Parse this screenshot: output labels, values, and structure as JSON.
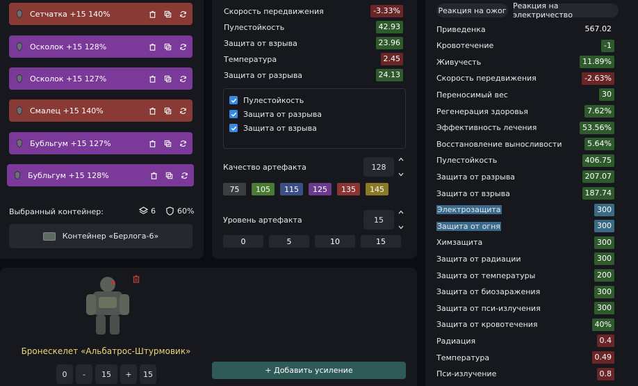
{
  "artifacts": [
    {
      "label": "Сетчатка +15 140%",
      "color": "red"
    },
    {
      "label": "Осколок +15 128%",
      "color": "purple"
    },
    {
      "label": "Осколок +15 127%",
      "color": "purple"
    },
    {
      "label": "Смалец +15 140%",
      "color": "red"
    },
    {
      "label": "Бубльгум +15 127%",
      "color": "purple"
    },
    {
      "label": "Бубльгум +15 128%",
      "color": "purple"
    }
  ],
  "container": {
    "selected_label": "Выбранный контейнер:",
    "slots": "6",
    "protection": "60%",
    "name": "Контейнер «Берлога-6»"
  },
  "mid_stats": [
    {
      "label": "Скорость передвижения",
      "value": "-3.33%",
      "tone": "r"
    },
    {
      "label": "Пулестойкость",
      "value": "42.93",
      "tone": "g"
    },
    {
      "label": "Защита от взрыва",
      "value": "23.96",
      "tone": "g"
    },
    {
      "label": "Температура",
      "value": "2.45",
      "tone": "r"
    },
    {
      "label": "Защита от разрыва",
      "value": "24.13",
      "tone": "g"
    }
  ],
  "checklist": [
    "Пулестойкость",
    "Защита от разрыва",
    "Защита от взрыва"
  ],
  "quality": {
    "label": "Качество артефакта",
    "value": "128",
    "chips": [
      {
        "label": "75",
        "color": "#3a3d42"
      },
      {
        "label": "105",
        "color": "#4b7a34"
      },
      {
        "label": "115",
        "color": "#3a4f86"
      },
      {
        "label": "125",
        "color": "#6c3a8c"
      },
      {
        "label": "135",
        "color": "#8a3434"
      },
      {
        "label": "145",
        "color": "#8a7a24"
      }
    ]
  },
  "level": {
    "label": "Уровень артефакта",
    "value": "15",
    "chips": [
      "0",
      "5",
      "10",
      "15"
    ]
  },
  "reactions": [
    "Реакция на ожог",
    "Реакция на электричество"
  ],
  "props": [
    {
      "label": "Приведенка",
      "value": "567.02",
      "tone": "n",
      "hl": false
    },
    {
      "label": "Кровотечение",
      "value": "-1",
      "tone": "g",
      "hl": false
    },
    {
      "label": "Живучесть",
      "value": "11.89%",
      "tone": "g",
      "hl": false
    },
    {
      "label": "Скорость передвижения",
      "value": "-2.63%",
      "tone": "r",
      "hl": false
    },
    {
      "label": "Переносимый вес",
      "value": "30",
      "tone": "g",
      "hl": false
    },
    {
      "label": "Регенерация здоровья",
      "value": "7.62%",
      "tone": "g",
      "hl": false
    },
    {
      "label": "Эффективность лечения",
      "value": "53.56%",
      "tone": "g",
      "hl": false
    },
    {
      "label": "Восстановление выносливости",
      "value": "5.64%",
      "tone": "g",
      "hl": false
    },
    {
      "label": "Пулестойкость",
      "value": "406.75",
      "tone": "g",
      "hl": false
    },
    {
      "label": "Защита от разрыва",
      "value": "207.07",
      "tone": "g",
      "hl": false
    },
    {
      "label": "Защита от взрыва",
      "value": "187.74",
      "tone": "g",
      "hl": false
    },
    {
      "label": "Электрозащита",
      "value": "300",
      "tone": "b",
      "hl": true
    },
    {
      "label": "Защита от огня",
      "value": "300",
      "tone": "b",
      "hl": true
    },
    {
      "label": "Химзащита",
      "value": "300",
      "tone": "g",
      "hl": false
    },
    {
      "label": "Защита от радиации",
      "value": "300",
      "tone": "g",
      "hl": false
    },
    {
      "label": "Защита от температуры",
      "value": "200",
      "tone": "g",
      "hl": false
    },
    {
      "label": "Защита от биозаражения",
      "value": "300",
      "tone": "g",
      "hl": false
    },
    {
      "label": "Защита от пси-излучения",
      "value": "300",
      "tone": "g",
      "hl": false
    },
    {
      "label": "Защита от кровотечения",
      "value": "40%",
      "tone": "g",
      "hl": false
    },
    {
      "label": "Радиация",
      "value": "0.4",
      "tone": "r",
      "hl": false
    },
    {
      "label": "Температура",
      "value": "0.49",
      "tone": "r",
      "hl": false
    },
    {
      "label": "Пси-излучение",
      "value": "0.8",
      "tone": "r",
      "hl": false
    }
  ],
  "armor": {
    "name": "Бронескелет «Альбатрос-Штурмовик»",
    "steppers": [
      "0",
      "-",
      "15",
      "+",
      "15"
    ],
    "add_label": "+ Добавить усиление"
  }
}
